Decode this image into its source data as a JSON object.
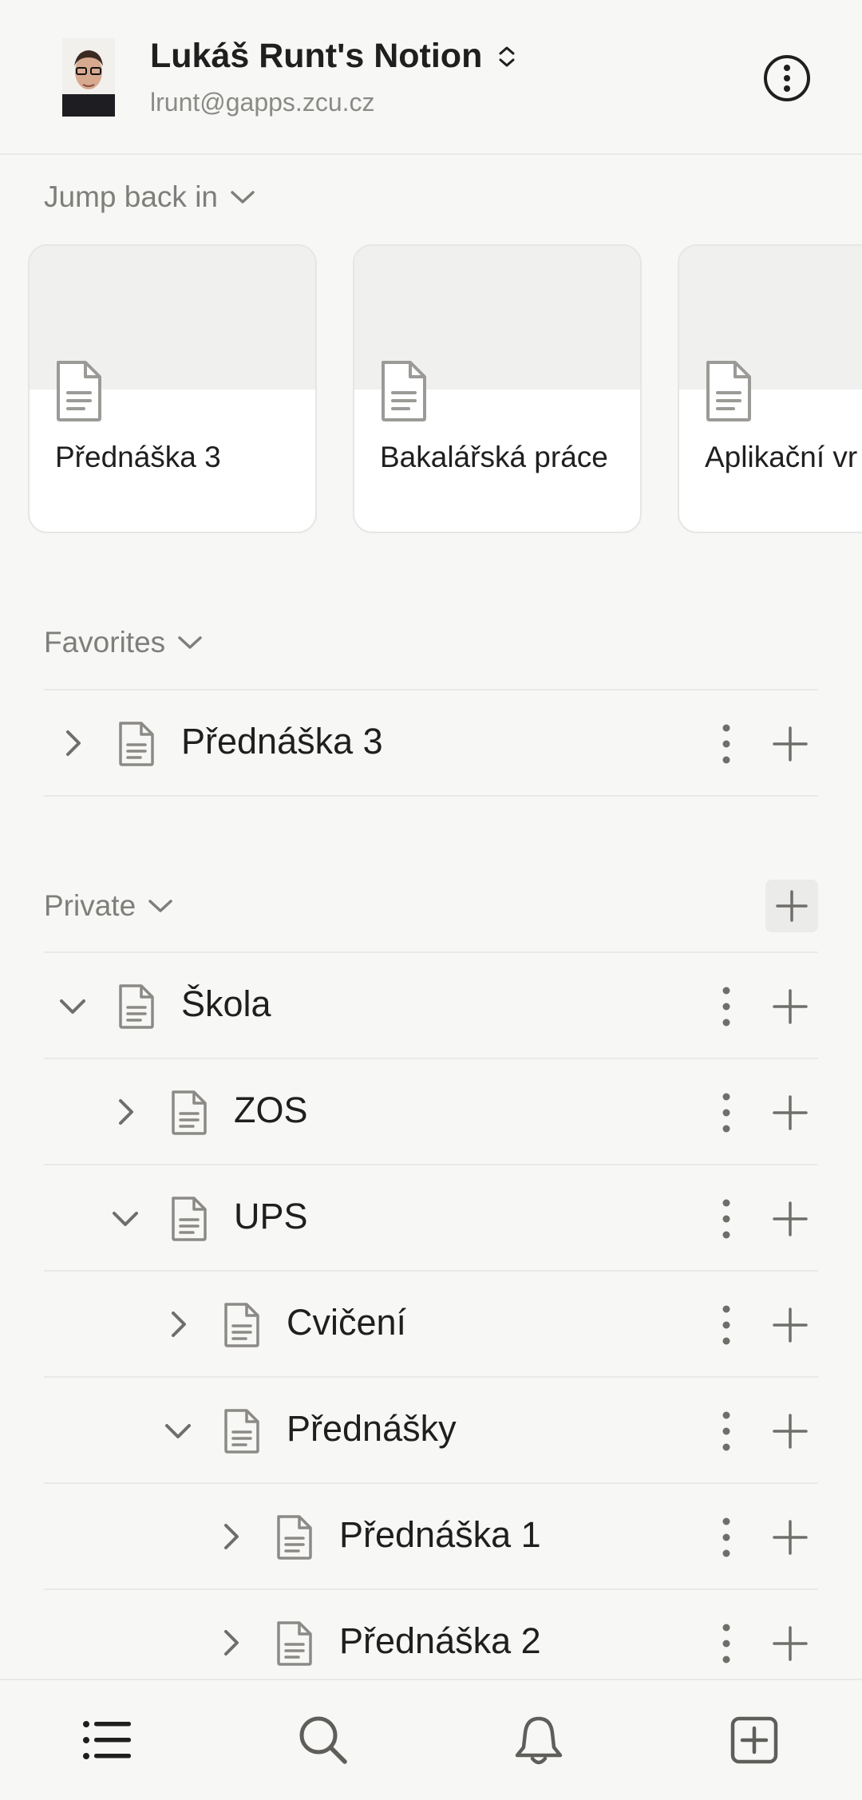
{
  "workspace": {
    "name": "Lukáš Runt's Notion",
    "email": "lrunt@gapps.zcu.cz"
  },
  "jump_back_in": {
    "label": "Jump back in",
    "cards": [
      {
        "title": "Přednáška 3"
      },
      {
        "title": "Bakalářská práce"
      },
      {
        "title": "Aplikační vr"
      }
    ]
  },
  "favorites": {
    "label": "Favorites",
    "items": [
      {
        "title": "Přednáška 3",
        "expanded": false
      }
    ]
  },
  "private": {
    "label": "Private",
    "items": [
      {
        "title": "Škola",
        "expanded": true,
        "depth": 0
      },
      {
        "title": "ZOS",
        "expanded": false,
        "depth": 1
      },
      {
        "title": "UPS",
        "expanded": true,
        "depth": 1
      },
      {
        "title": "Cvičení",
        "expanded": false,
        "depth": 2
      },
      {
        "title": "Přednášky",
        "expanded": true,
        "depth": 2
      },
      {
        "title": "Přednáška 1",
        "expanded": false,
        "depth": 3
      },
      {
        "title": "Přednáška 2",
        "expanded": false,
        "depth": 3
      }
    ]
  },
  "bottom_nav": {
    "items": [
      {
        "icon": "list-icon"
      },
      {
        "icon": "search-icon"
      },
      {
        "icon": "bell-icon"
      },
      {
        "icon": "new-page-icon"
      }
    ]
  },
  "colors": {
    "background": "#f7f7f5",
    "text": "#1f1f1f",
    "muted": "#7e7e7b",
    "divider": "#e9e9e7"
  }
}
